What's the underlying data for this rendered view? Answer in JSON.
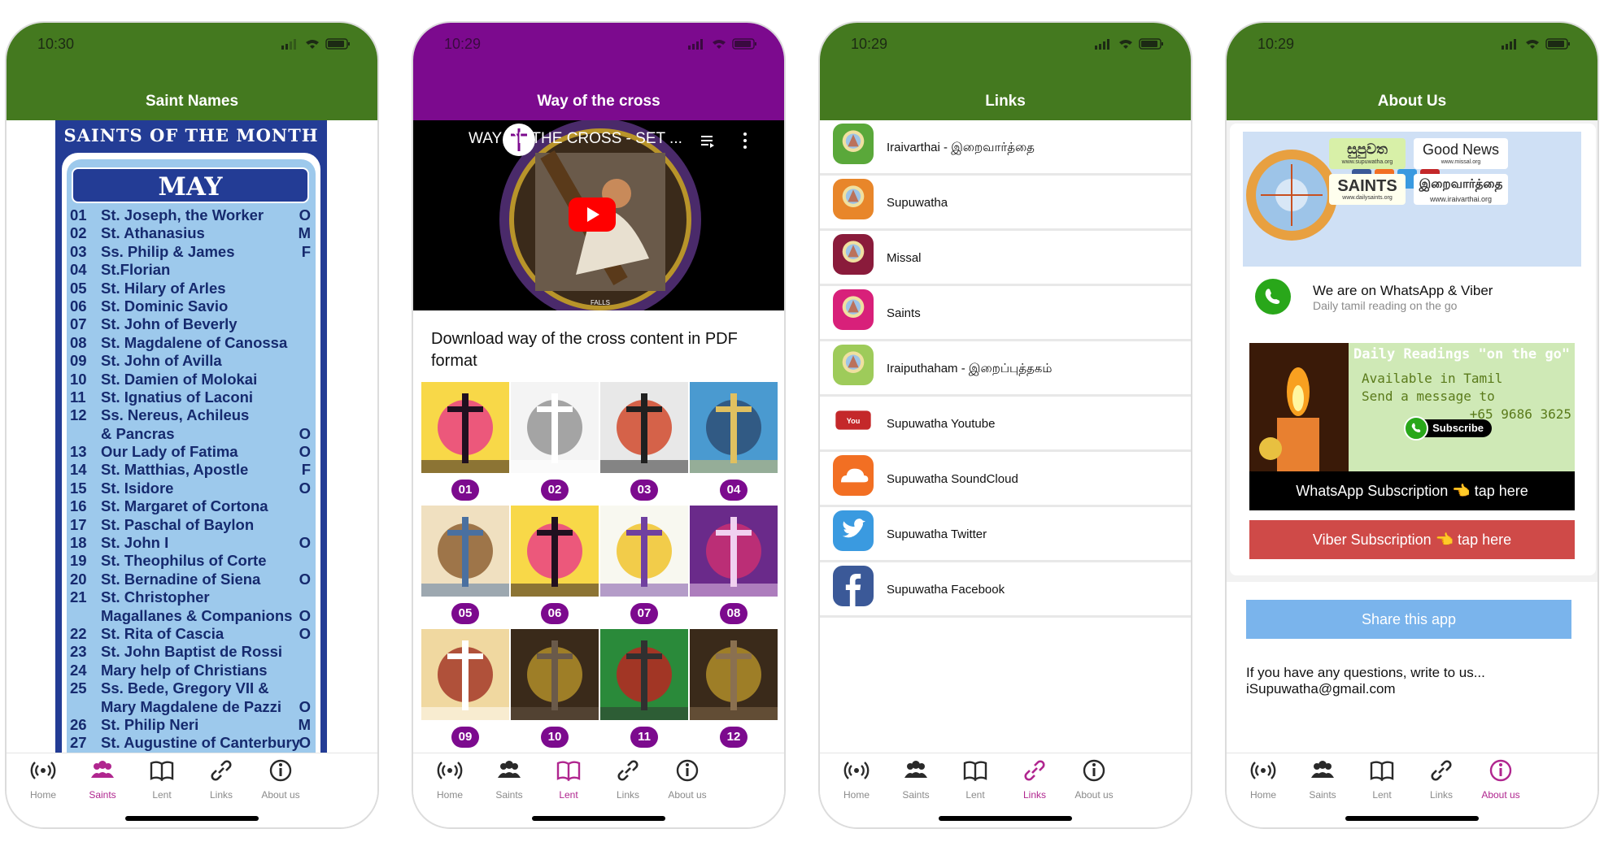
{
  "tabs": [
    {
      "label": "Home",
      "icon": "broadcast-icon"
    },
    {
      "label": "Saints",
      "icon": "people-icon"
    },
    {
      "label": "Lent",
      "icon": "book-icon"
    },
    {
      "label": "Links",
      "icon": "link-icon"
    },
    {
      "label": "About us",
      "icon": "info-icon"
    }
  ],
  "screen1": {
    "time": "10:30",
    "title": "Saint Names",
    "header": "SAINTS OF THE MONTH",
    "month": "MAY",
    "saints": [
      {
        "n": "01",
        "name": "St. Joseph, the Worker",
        "f": "O"
      },
      {
        "n": "02",
        "name": "St. Athanasius",
        "f": "M"
      },
      {
        "n": "03",
        "name": "Ss. Philip & James",
        "f": "F"
      },
      {
        "n": "04",
        "name": "St.Florian",
        "f": ""
      },
      {
        "n": "05",
        "name": "St. Hilary of Arles",
        "f": ""
      },
      {
        "n": "06",
        "name": "St. Dominic Savio",
        "f": ""
      },
      {
        "n": "07",
        "name": "St. John of Beverly",
        "f": ""
      },
      {
        "n": "08",
        "name": "St. Magdalene of Canossa",
        "f": ""
      },
      {
        "n": "09",
        "name": "St. John of Avilla",
        "f": ""
      },
      {
        "n": "10",
        "name": "St. Damien of Molokai",
        "f": ""
      },
      {
        "n": "11",
        "name": "St. Ignatius of Laconi",
        "f": ""
      },
      {
        "n": "12",
        "name": "Ss. Nereus, Achileus",
        "f": ""
      },
      {
        "n": "",
        "name": "& Pancras",
        "f": "O"
      },
      {
        "n": "13",
        "name": "Our Lady of Fatima",
        "f": "O"
      },
      {
        "n": "14",
        "name": "St. Matthias, Apostle",
        "f": "F"
      },
      {
        "n": "15",
        "name": "St. Isidore",
        "f": "O"
      },
      {
        "n": "16",
        "name": "St. Margaret of Cortona",
        "f": ""
      },
      {
        "n": "17",
        "name": "St. Paschal of Baylon",
        "f": ""
      },
      {
        "n": "18",
        "name": "St. John I",
        "f": "O"
      },
      {
        "n": "19",
        "name": "St. Theophilus of Corte",
        "f": ""
      },
      {
        "n": "20",
        "name": "St. Bernadine of Siena",
        "f": "O"
      },
      {
        "n": "21",
        "name": "St. Christopher",
        "f": ""
      },
      {
        "n": "",
        "name": "Magallanes & Companions",
        "f": "O"
      },
      {
        "n": "22",
        "name": "St. Rita of Cascia",
        "f": "O"
      },
      {
        "n": "23",
        "name": "St. John Baptist de Rossi",
        "f": ""
      },
      {
        "n": "24",
        "name": "Mary help of Christians",
        "f": ""
      },
      {
        "n": "25",
        "name": "Ss. Bede, Gregory VII &",
        "f": ""
      },
      {
        "n": "",
        "name": "Mary Magdalene de Pazzi",
        "f": "O"
      },
      {
        "n": "26",
        "name": "St. Philip Neri",
        "f": "M"
      },
      {
        "n": "27",
        "name": "St. Augustine of Canterbury",
        "f": "O"
      }
    ],
    "active_tab": 1
  },
  "screen2": {
    "time": "10:29",
    "title": "Way of the cross",
    "video_title": "WAY OF THE CROSS - SET ...",
    "download_text": "Download way of the cross content in PDF format",
    "stations": [
      "01",
      "02",
      "03",
      "04",
      "05",
      "06",
      "07",
      "08",
      "09",
      "10",
      "11",
      "12"
    ],
    "active_tab": 2
  },
  "screen3": {
    "time": "10:29",
    "title": "Links",
    "links": [
      {
        "label": "Iraivarthai - இறைவார்த்தை",
        "icon": "iraivarthai-app-icon",
        "color": "#5aa83a"
      },
      {
        "label": "Supuwatha",
        "icon": "supuwatha-app-icon",
        "color": "#e8862a"
      },
      {
        "label": "Missal",
        "icon": "missal-app-icon",
        "color": "#8a1b3b"
      },
      {
        "label": "Saints",
        "icon": "saints-app-icon",
        "color": "#d8207a"
      },
      {
        "label": "Iraiputhaham - இறைப்புத்தகம்",
        "icon": "iraiputhaham-app-icon",
        "color": "#9ecb5a"
      },
      {
        "label": "Supuwatha Youtube",
        "icon": "youtube-icon",
        "color": "#c4282a"
      },
      {
        "label": "Supuwatha SoundCloud",
        "icon": "soundcloud-icon",
        "color": "#f26f23"
      },
      {
        "label": "Supuwatha Twitter",
        "icon": "twitter-icon",
        "color": "#3a9ae0"
      },
      {
        "label": "Supuwatha Facebook",
        "icon": "facebook-icon",
        "color": "#3b5998"
      }
    ],
    "active_tab": 3
  },
  "screen4": {
    "time": "10:29",
    "title": "About Us",
    "banner": {
      "good_news": "Good News",
      "good_news_url": "www.missal.org",
      "supuwatha": "සුපුවත",
      "supuwatha_url": "www.supuwatha.org",
      "saints": "SAINTS",
      "saints_url": "www.dailysaints.org",
      "tamil": "இறைவார்த்தை",
      "tamil_url": "www.iraivarthai.org"
    },
    "whatsapp_line1": "We are on WhatsApp & Viber",
    "whatsapp_line2": "Daily tamil reading on the go",
    "ad": {
      "line1": "Daily Readings \"on the go\"",
      "line2": "Available in Tamil",
      "line3": "Send a message to",
      "phone": "+65 9686 3625",
      "subscribe": "Subscribe"
    },
    "whatsapp_button": "WhatsApp Subscription 👈 tap here",
    "viber_button": "Viber Subscription 👈 tap here",
    "share_button": "Share this app",
    "question": "If you have any questions, write to us...",
    "email": "iSupuwatha@gmail.com",
    "active_tab": 4
  }
}
